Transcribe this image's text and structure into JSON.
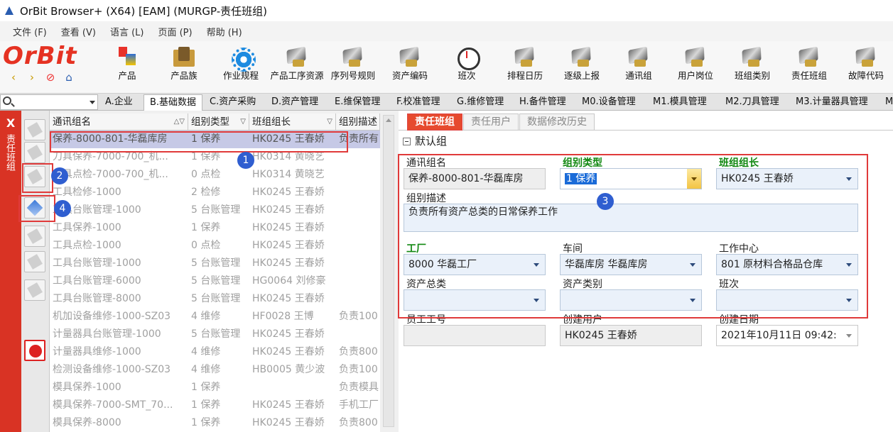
{
  "window": {
    "title": "OrBit Browser+ (X64) [EAM] (MURGP-责任班组)"
  },
  "menu": [
    "文件 (F)",
    "查看 (V)",
    "语言 (L)",
    "页面 (P)",
    "帮助 (H)"
  ],
  "logo": "OrBit",
  "toolbar": [
    "产品",
    "产品族",
    "作业规程",
    "产品工序资源",
    "序列号规则",
    "资产编码",
    "班次",
    "排程日历",
    "逐级上报",
    "通讯组",
    "用户岗位",
    "班组类别",
    "责任班组",
    "故障代码"
  ],
  "module_tabs": [
    "A.企业",
    "B.基础数据",
    "C.资产采购",
    "D.资产管理",
    "E.维保管理",
    "F.校准管理",
    "G.维修管理",
    "H.备件管理",
    "M0.设备管理",
    "M1.模具管理",
    "M2.刀具管理",
    "M3.计量器具管理",
    "M"
  ],
  "active_module_tab": "B.基础数据",
  "side_panel": {
    "close": "X",
    "title": "责任班组"
  },
  "grid": {
    "columns": [
      "通讯组名",
      "组别类型",
      "班组组长",
      "组别描述"
    ],
    "rows": [
      [
        "保养-8000-801-华磊库房",
        "1 保养",
        "HK0245 王春娇",
        "负责所有"
      ],
      [
        "刀具保养-7000-700_机...",
        "1 保养",
        "HK0314 黄晓艺",
        ""
      ],
      [
        "刀具点检-7000-700_机...",
        "0 点检",
        "HK0314 黄晓艺",
        ""
      ],
      [
        "工具检修-1000",
        "2 检修",
        "HK0245 王春娇",
        ""
      ],
      [
        "工具台账管理-1000",
        "5 台账管理",
        "HK0245 王春娇",
        ""
      ],
      [
        "工具保养-1000",
        "1 保养",
        "HK0245 王春娇",
        ""
      ],
      [
        "工具点检-1000",
        "0 点检",
        "HK0245 王春娇",
        ""
      ],
      [
        "工具台账管理-1000",
        "5 台账管理",
        "HK0245 王春娇",
        ""
      ],
      [
        "工具台账管理-6000",
        "5 台账管理",
        "HG0064 刘修豪",
        ""
      ],
      [
        "工具台账管理-8000",
        "5 台账管理",
        "HK0245 王春娇",
        ""
      ],
      [
        "机加设备维修-1000-SZ03",
        "4 维修",
        "HF0028 王博",
        "负责100"
      ],
      [
        "计量器具台账管理-1000",
        "5 台账管理",
        "HK0245 王春娇",
        ""
      ],
      [
        "计量器具维修-1000",
        "4 维修",
        "HK0245 王春娇",
        "负责800"
      ],
      [
        "检测设备维修-1000-SZ03",
        "4 维修",
        "HB0005 黄少波",
        "负责100"
      ],
      [
        "模具保养-1000",
        "1 保养",
        "",
        "负责模具"
      ],
      [
        "模具保养-7000-SMT_70...",
        "1 保养",
        "HK0245 王春娇",
        "手机工厂"
      ],
      [
        "模具保养-8000",
        "1 保养",
        "HK0245 王春娇",
        "负责800"
      ]
    ]
  },
  "detail_tabs": [
    "责任班组",
    "责任用户",
    "数据修改历史"
  ],
  "section": "默认组",
  "form": {
    "group_name_label": "通讯组名",
    "group_name": "保养-8000-801-华磊库房",
    "group_type_label": "组别类型",
    "group_type": "1 保养",
    "leader_label": "班组组长",
    "leader": "HK0245 王春娇",
    "desc_label": "组别描述",
    "desc": "负责所有资产总类的日常保养工作",
    "factory_label": "工厂",
    "factory": "8000 华磊工厂",
    "workshop_label": "车间",
    "workshop": "华磊库房 华磊库房",
    "workcenter_label": "工作中心",
    "workcenter": "801 原材料合格品仓库",
    "asset_class_label": "资产总类",
    "asset_class": "",
    "asset_type_label": "资产类别",
    "asset_type": "",
    "shift_label": "班次",
    "shift": "",
    "emp_label": "员工工号",
    "emp": "",
    "creator_label": "创建用户",
    "creator": "HK0245 王春娇",
    "created_label": "创建日期",
    "created": "2021年10月11日 09:42:"
  },
  "badges": [
    "1",
    "2",
    "3",
    "4"
  ]
}
